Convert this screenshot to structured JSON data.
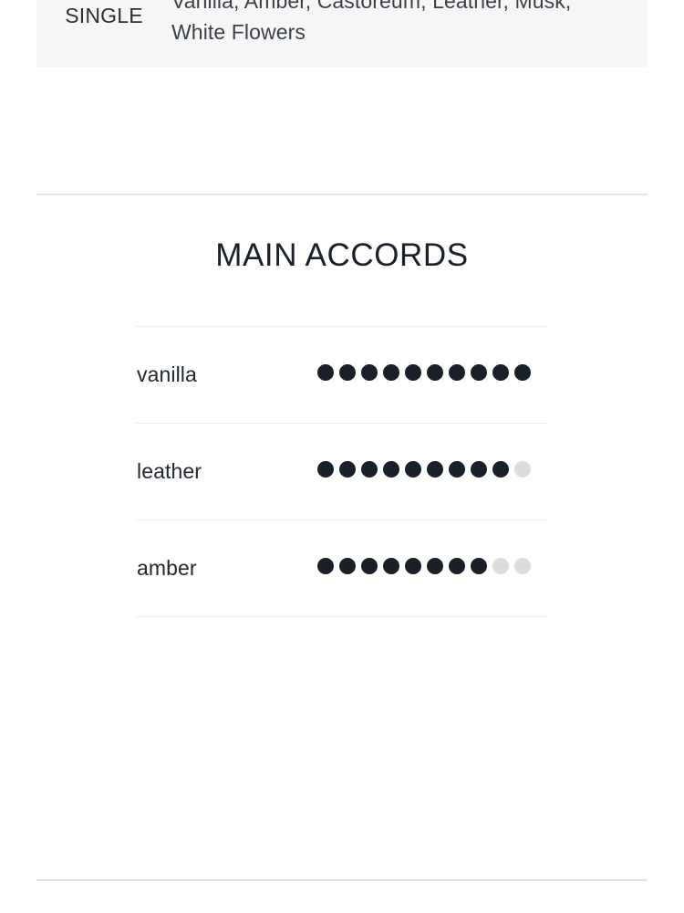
{
  "colors": {
    "accent_dark": "#1a2028",
    "dot_empty": "#dcdcdc",
    "band_background": "#f6f6f7",
    "rule": "#e2e3e5",
    "row_rule": "#eceded",
    "text": "#1f262e"
  },
  "info_row": {
    "label": "SINGLE",
    "value": "Vanilla, Amber, Castoreum, Leather, Musk, White Flowers"
  },
  "accords": {
    "title": "MAIN ACCORDS",
    "scale_max": 10,
    "items": [
      {
        "name": "vanilla",
        "filled": 10
      },
      {
        "name": "leather",
        "filled": 9
      },
      {
        "name": "amber",
        "filled": 8
      }
    ]
  }
}
